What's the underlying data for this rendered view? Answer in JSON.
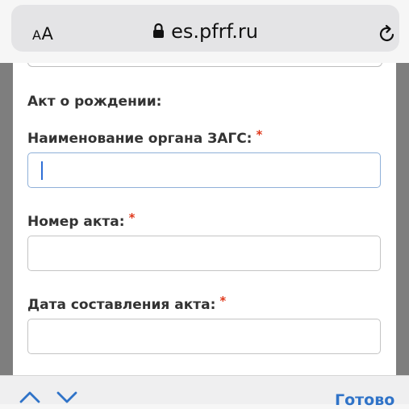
{
  "browser": {
    "text_size_label": "AA",
    "url": "es.pfrf.ru"
  },
  "form": {
    "section_title": "Акт о рождении:",
    "fields": [
      {
        "label": "Наименование органа ЗАГС:",
        "required_mark": "*",
        "value": ""
      },
      {
        "label": "Номер акта:",
        "required_mark": "*",
        "value": ""
      },
      {
        "label": "Дата составления акта:",
        "required_mark": "*",
        "value": ""
      }
    ]
  },
  "keyboard_toolbar": {
    "done_label": "Готово"
  }
}
